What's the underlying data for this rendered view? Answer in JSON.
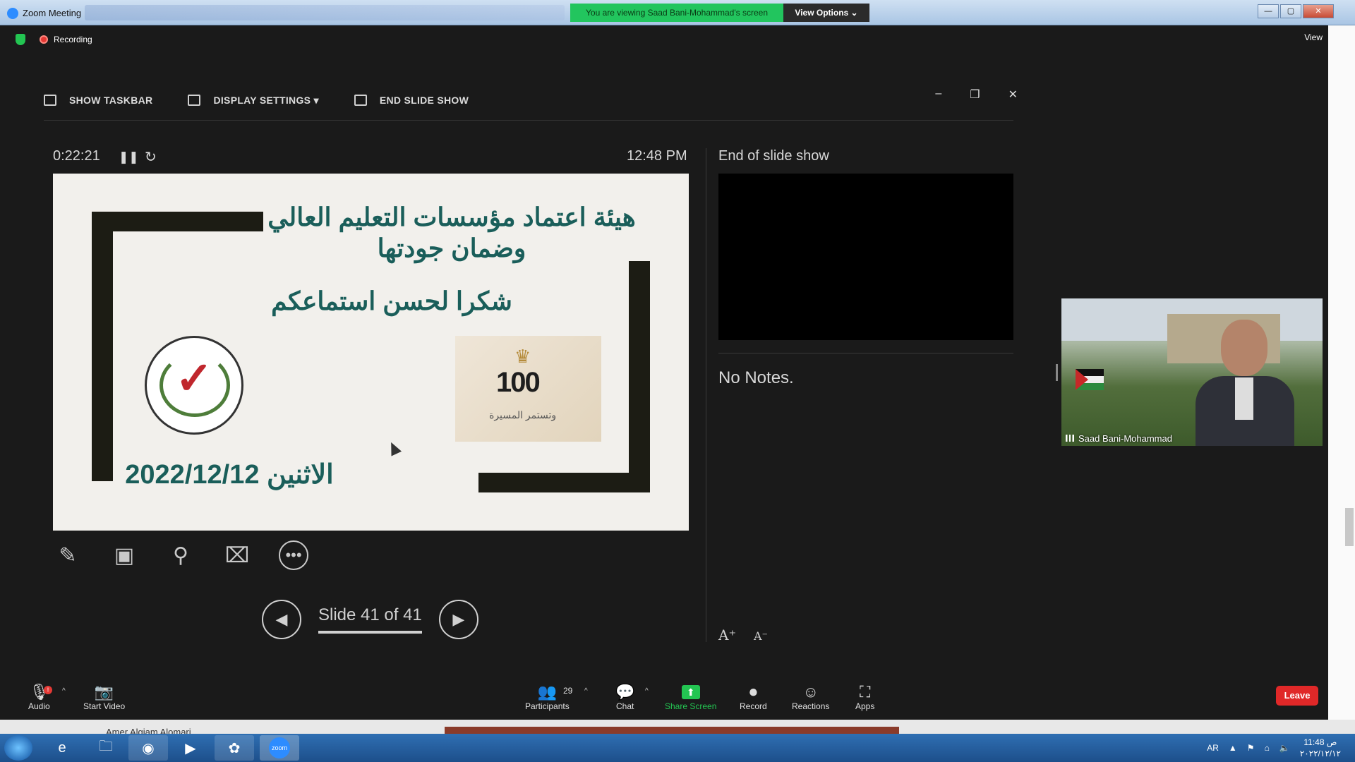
{
  "window": {
    "title": "Zoom Meeting",
    "share_banner": "You are viewing Saad Bani-Mohammad's screen",
    "view_options": "View Options ⌄"
  },
  "zoom_top": {
    "recording_label": "Recording",
    "view_label": "View"
  },
  "presenter_toolbar": {
    "show_taskbar": "SHOW TASKBAR",
    "display_settings": "DISPLAY SETTINGS ▾",
    "end_slide_show": "END SLIDE SHOW"
  },
  "presenter": {
    "timer": "0:22:21",
    "clock": "12:48 PM",
    "next_label": "End of slide show",
    "notes": "No Notes.",
    "slide_counter": "Slide 41 of 41"
  },
  "slide": {
    "title": "هيئة اعتماد مؤسسات التعليم العالي وضمان جودتها",
    "subtitle": "شكرا لحسن استماعكم",
    "date": "الاثنين 2022/12/12",
    "logo_right_number": "100",
    "logo_right_motto": "وتستمر المسيرة"
  },
  "video": {
    "participant_name": "Saad Bani-Mohammad"
  },
  "bottom_bar": {
    "audio": "Audio",
    "start_video": "Start Video",
    "participants": "Participants",
    "participants_count": "29",
    "chat": "Chat",
    "share_screen": "Share Screen",
    "record": "Record",
    "reactions": "Reactions",
    "apps": "Apps",
    "leave": "Leave"
  },
  "background": {
    "name_partial": "Amer Alqiam Alomari"
  },
  "taskbar": {
    "language": "AR",
    "time": "11:48 ص",
    "date": "٢٠٢٢/١٢/١٢"
  },
  "colors": {
    "share_green": "#22c55e",
    "leave_red": "#e02828",
    "slide_text": "#1a5e5a",
    "taskbar_blue": "#1d4f8b"
  }
}
